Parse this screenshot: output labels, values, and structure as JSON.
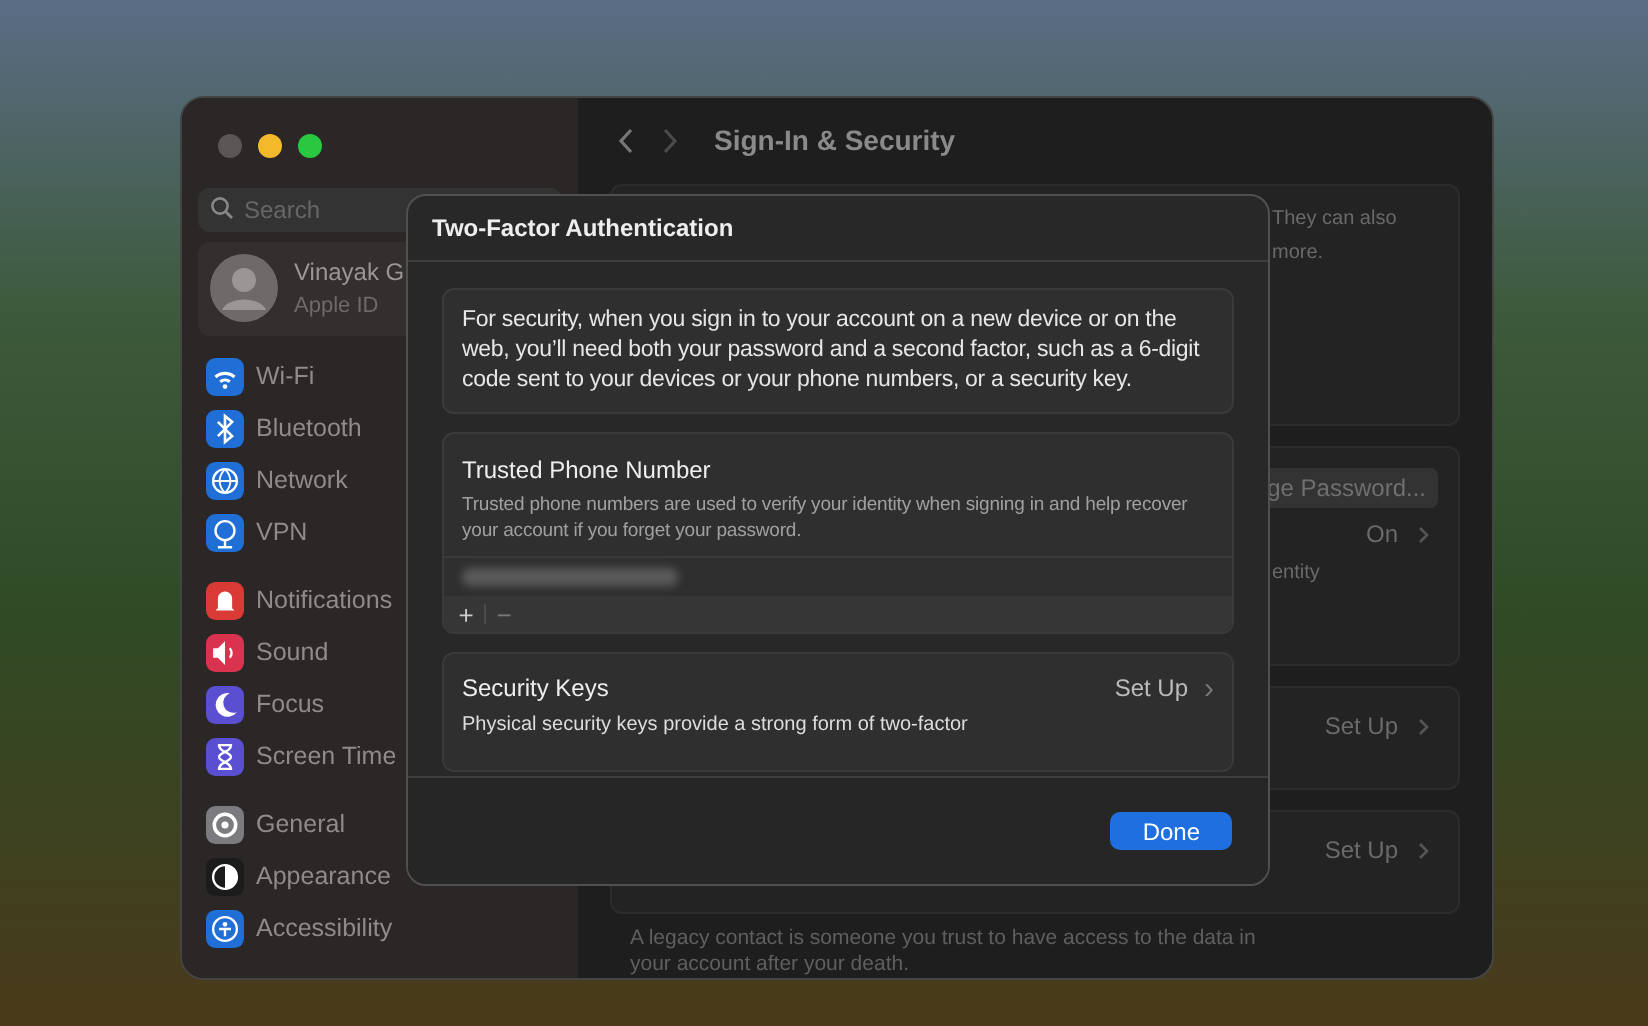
{
  "window": {
    "title": "Sign-In & Security"
  },
  "sidebar": {
    "search": {
      "placeholder": "Search"
    },
    "account": {
      "name": "Vinayak G",
      "subtitle": "Apple ID"
    },
    "groups": [
      [
        {
          "label": "Wi-Fi",
          "kind": "wifi",
          "color": "#1f6fd6"
        },
        {
          "label": "Bluetooth",
          "kind": "bluetooth",
          "color": "#1f6fd6"
        },
        {
          "label": "Network",
          "kind": "globe",
          "color": "#1f6fd6"
        },
        {
          "label": "VPN",
          "kind": "vpn",
          "color": "#1f6fd6"
        }
      ],
      [
        {
          "label": "Notifications",
          "kind": "bell",
          "color": "#d93a35"
        },
        {
          "label": "Sound",
          "kind": "speaker",
          "color": "#d9334f"
        },
        {
          "label": "Focus",
          "kind": "moon",
          "color": "#5b4fd1"
        },
        {
          "label": "Screen Time",
          "kind": "hourglass",
          "color": "#5b4fd1"
        }
      ],
      [
        {
          "label": "General",
          "kind": "gear",
          "color": "#7b7b80"
        },
        {
          "label": "Appearance",
          "kind": "contrast",
          "color": "#1b1b1b"
        },
        {
          "label": "Accessibility",
          "kind": "person",
          "color": "#1f6fd6"
        }
      ]
    ]
  },
  "background_panel": {
    "cards": [
      {
        "lines": [
          "They can also",
          "more."
        ]
      },
      {
        "button": "ge Password...",
        "value": "On",
        "lines": [
          "entity"
        ]
      },
      {
        "value": "Set Up"
      },
      {
        "value": "Set Up"
      }
    ],
    "footnote": [
      "A legacy contact is someone you trust to have access to the data in",
      "your account after your death."
    ]
  },
  "dialog": {
    "title": "Two-Factor Authentication",
    "intro": "For security, when you sign in to your account on a new device or on the web, you’ll need both your password and a second factor, such as a 6-digit code sent to your devices or your phone numbers, or a security key.",
    "phone_section": {
      "title": "Trusted Phone Number",
      "description": "Trusted phone numbers are used to verify your identity when signing in and help recover your account if you forget your password.",
      "add": "+",
      "remove": "−"
    },
    "keys_section": {
      "title": "Security Keys",
      "description": "Physical security keys provide a strong form of two-factor",
      "action": "Set Up",
      "chevron": "›"
    },
    "button": "Done"
  }
}
